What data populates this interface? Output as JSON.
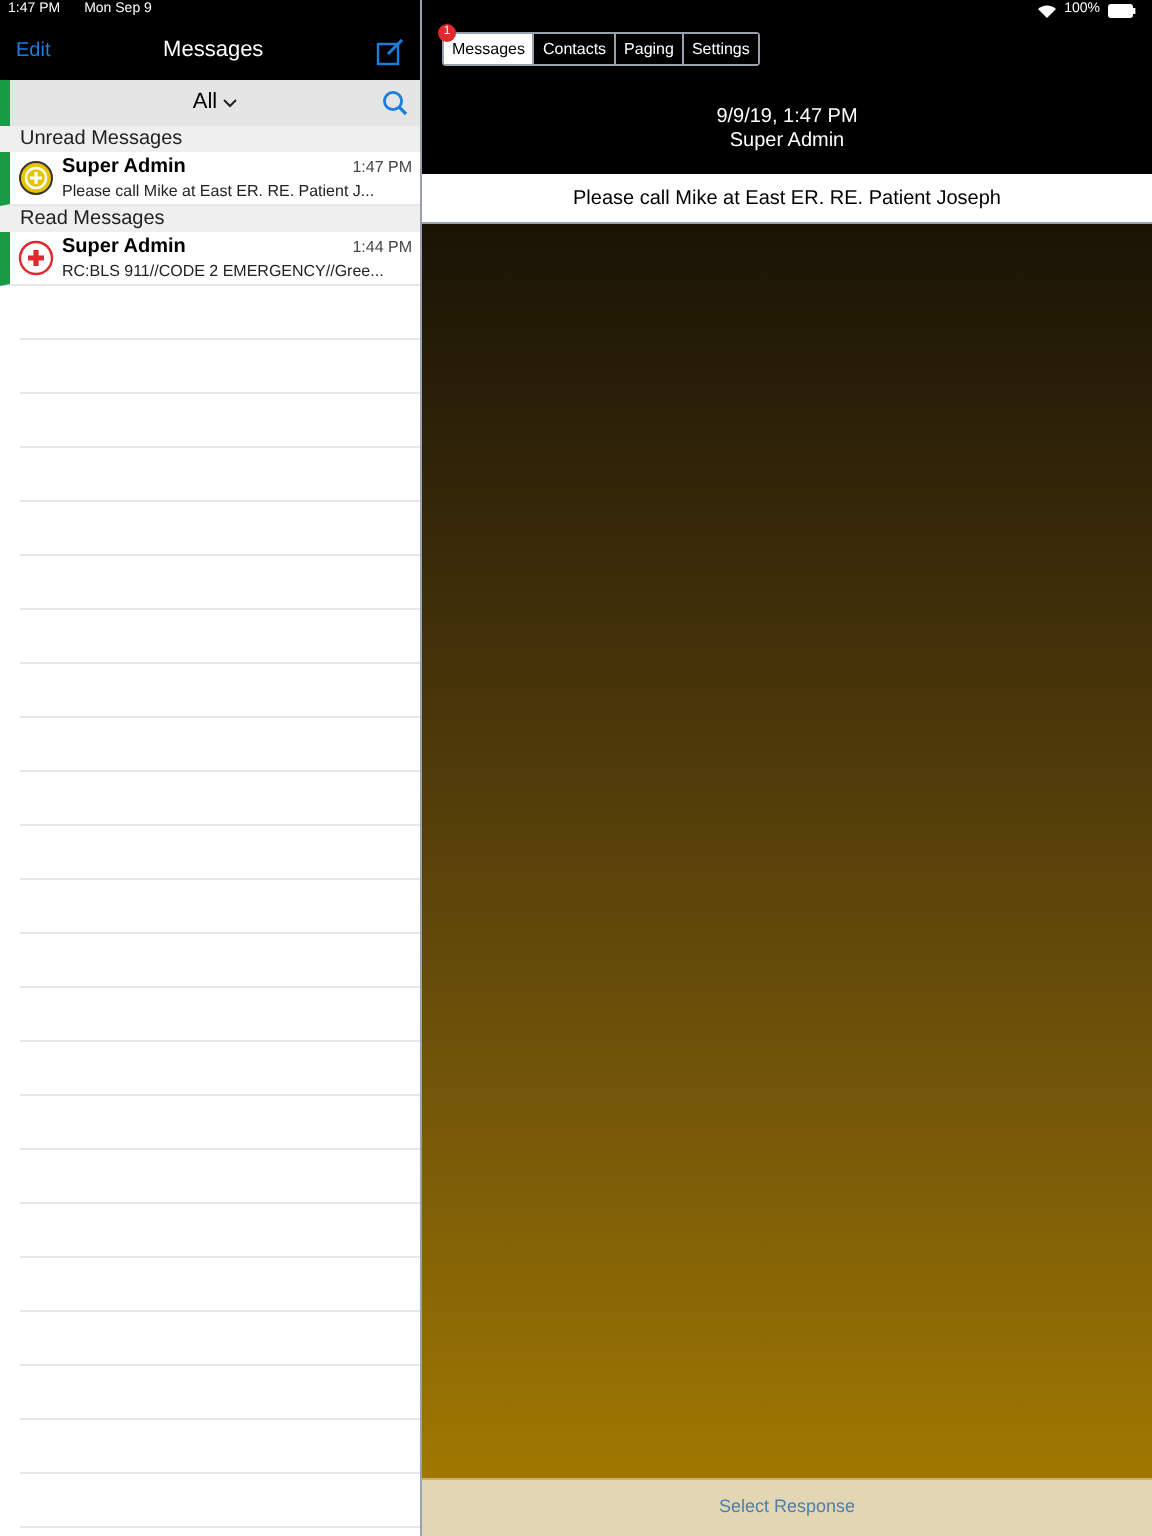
{
  "status_bar": {
    "time": "1:47 PM",
    "date": "Mon Sep 9",
    "battery": "100%"
  },
  "nav": {
    "edit": "Edit",
    "title": "Messages"
  },
  "filter": {
    "label": "All"
  },
  "sections": [
    {
      "title": "Unread Messages",
      "messages": [
        {
          "kind": "plus",
          "sender": "Super Admin",
          "time": "1:47 PM",
          "preview": "Please call Mike at East ER. RE. Patient J..."
        }
      ]
    },
    {
      "title": "Read Messages",
      "messages": [
        {
          "kind": "cross",
          "sender": "Super Admin",
          "time": "1:44 PM",
          "preview": "RC:BLS 911//CODE 2 EMERGENCY//Gree..."
        }
      ]
    }
  ],
  "tabs": [
    {
      "label": "Messages",
      "selected": true,
      "badge": "1"
    },
    {
      "label": "Contacts",
      "selected": false
    },
    {
      "label": "Paging",
      "selected": false
    },
    {
      "label": "Settings",
      "selected": false
    }
  ],
  "detail": {
    "timestamp": "9/9/19, 1:47 PM",
    "sender": "Super Admin",
    "message": "Please call Mike at East ER. RE. Patient Joseph"
  },
  "response_button": "Select Response"
}
